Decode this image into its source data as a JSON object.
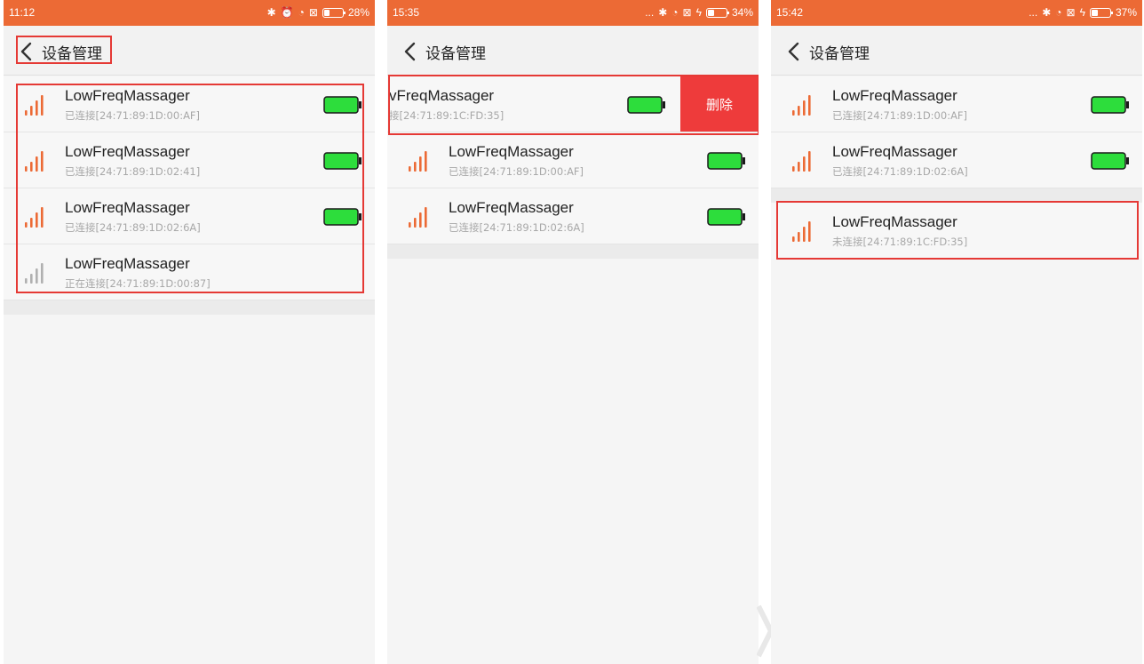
{
  "colors": {
    "accent": "#ec6a35",
    "signal_active": "#ec6a35",
    "signal_inactive": "#b0b0b0",
    "battery_fill": "#2ddd3c",
    "delete": "#ee3b3b",
    "highlight": "#e53935"
  },
  "screens": [
    {
      "status": {
        "time": "11:12",
        "battery": "28%",
        "battery_level": 0.28
      },
      "title": "设备管理",
      "devices": [
        {
          "name": "LowFreqMassager",
          "status": "已连接[24:71:89:1D:00:AF]",
          "signal": "active",
          "battery_full": true
        },
        {
          "name": "LowFreqMassager",
          "status": "已连接[24:71:89:1D:02:41]",
          "signal": "active",
          "battery_full": true
        },
        {
          "name": "LowFreqMassager",
          "status": "已连接[24:71:89:1D:02:6A]",
          "signal": "active",
          "battery_full": true
        },
        {
          "name": "LowFreqMassager",
          "status": "正在连接[24:71:89:1D:00:87]",
          "signal": "inactive",
          "battery_full": false
        }
      ]
    },
    {
      "status": {
        "time": "15:35",
        "battery": "34%",
        "battery_level": 0.34,
        "more": "..."
      },
      "title": "设备管理",
      "swiped_device": {
        "name": "vFreqMassager",
        "status": "接[24:71:89:1C:FD:35]",
        "delete_label": "删除"
      },
      "devices": [
        {
          "name": "LowFreqMassager",
          "status": "已连接[24:71:89:1D:00:AF]",
          "signal": "active",
          "battery_full": true
        },
        {
          "name": "LowFreqMassager",
          "status": "已连接[24:71:89:1D:02:6A]",
          "signal": "active",
          "battery_full": true
        }
      ]
    },
    {
      "status": {
        "time": "15:42",
        "battery": "37%",
        "battery_level": 0.37,
        "more": "..."
      },
      "title": "设备管理",
      "devices": [
        {
          "name": "LowFreqMassager",
          "status": "已连接[24:71:89:1D:00:AF]",
          "signal": "active",
          "battery_full": true
        },
        {
          "name": "LowFreqMassager",
          "status": "已连接[24:71:89:1D:02:6A]",
          "signal": "active",
          "battery_full": true
        }
      ],
      "disconnected_device": {
        "name": "LowFreqMassager",
        "status": "未连接[24:71:89:1C:FD:35]"
      }
    }
  ]
}
